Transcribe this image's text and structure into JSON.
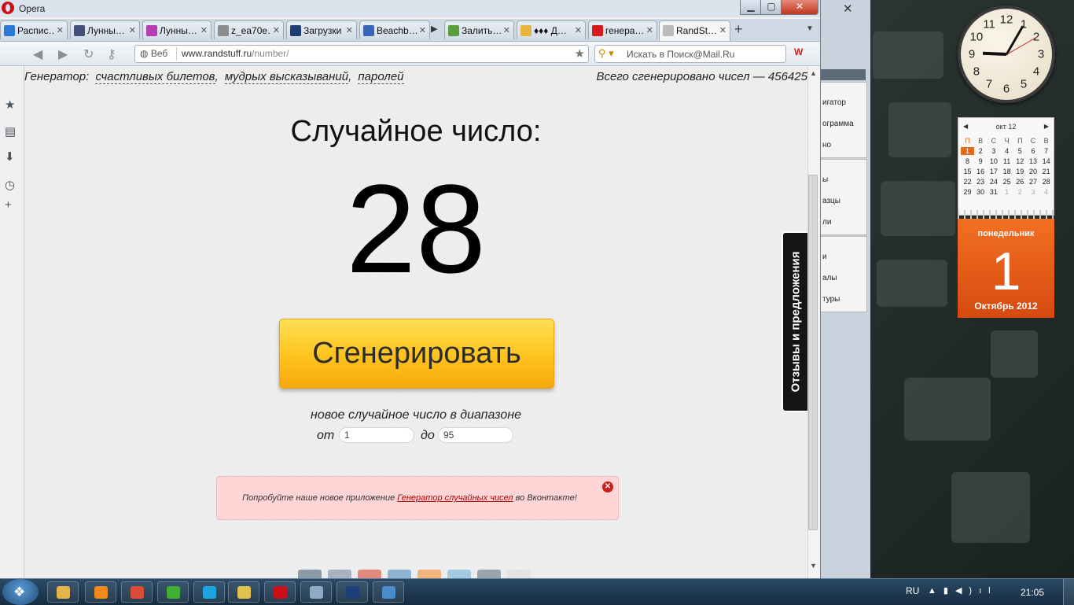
{
  "window": {
    "app_name": "Opera"
  },
  "tabs": [
    {
      "label": "Распис…",
      "color": "#2a7ad5"
    },
    {
      "label": "Лунны…",
      "color": "#444f7a"
    },
    {
      "label": "Лунны…",
      "color": "#b63db0"
    },
    {
      "label": "z_ea70e…",
      "color": "#8c8c8c"
    },
    {
      "label": "Загрузки",
      "color": "#1e3f74"
    },
    {
      "label": "Beachb…",
      "color": "#3a66b8"
    },
    {
      "label": "Залить…",
      "color": "#5a9d3b"
    },
    {
      "label": "♦♦♦ Д…",
      "color": "#e9b43b"
    },
    {
      "label": "генера…",
      "color": "#d71a1a"
    },
    {
      "label": "RandSt…",
      "color": "#bbbbbb"
    }
  ],
  "navbar": {
    "address_label": "Веб",
    "url_host": "www.randstuff.ru",
    "url_path": "/number/",
    "search_placeholder": "Искать в Поиск@Mail.Ru"
  },
  "page": {
    "generator_prefix": "Генератор:",
    "links": [
      "счастливых билетов",
      "мудрых высказываний",
      "паролей"
    ],
    "counter": "Всего сгенерировано чисел — 456425",
    "heading": "Случайное число:",
    "number": "28",
    "button": "Сгенерировать",
    "range_text": "новое случайное число в диапазоне",
    "from_label": "от",
    "from_value": "1",
    "to_label": "до",
    "to_value": "95",
    "promo_prefix": "Попробуйте наше новое приложение",
    "promo_link": "Генератор случайных чисел",
    "promo_suffix": "во Вконтакте!",
    "feedback": "Отзывы и предложения"
  },
  "bg_window": {
    "items": [
      "игатор",
      "ограмма",
      "но",
      "ы",
      "азцы",
      "ли",
      "и",
      "алы",
      "туры"
    ]
  },
  "clock": {
    "hour_numbers": [
      "12",
      "1",
      "2",
      "3",
      "4",
      "5",
      "6",
      "7",
      "8",
      "9",
      "10",
      "11"
    ]
  },
  "calendar": {
    "month": "окт 12",
    "weekdays": [
      "П",
      "В",
      "С",
      "Ч",
      "П",
      "С",
      "В"
    ],
    "weeks": [
      [
        "1",
        "2",
        "3",
        "4",
        "5",
        "6",
        "7"
      ],
      [
        "8",
        "9",
        "10",
        "11",
        "12",
        "13",
        "14"
      ],
      [
        "15",
        "16",
        "17",
        "18",
        "19",
        "20",
        "21"
      ],
      [
        "22",
        "23",
        "24",
        "25",
        "26",
        "27",
        "28"
      ],
      [
        "29",
        "30",
        "31",
        "1",
        "2",
        "3",
        "4"
      ]
    ],
    "weekday_big": "понедельник",
    "day_big": "1",
    "month_year": "Октябрь 2012"
  },
  "taskbar": {
    "language": "RU",
    "time": "21:05",
    "apps": [
      {
        "name": "explorer",
        "color": "#e2b449"
      },
      {
        "name": "media-player",
        "color": "#f08a1c"
      },
      {
        "name": "chrome",
        "color": "#dd4b39"
      },
      {
        "name": "utorrent",
        "color": "#3fae32"
      },
      {
        "name": "skype",
        "color": "#1ea4e0"
      },
      {
        "name": "movie-maker",
        "color": "#e0c24a"
      },
      {
        "name": "opera",
        "color": "#cc0f16"
      },
      {
        "name": "calculator",
        "color": "#8faac4"
      },
      {
        "name": "photoshop",
        "color": "#1b3f79"
      },
      {
        "name": "remote-desktop",
        "color": "#4a8dcb"
      }
    ]
  }
}
